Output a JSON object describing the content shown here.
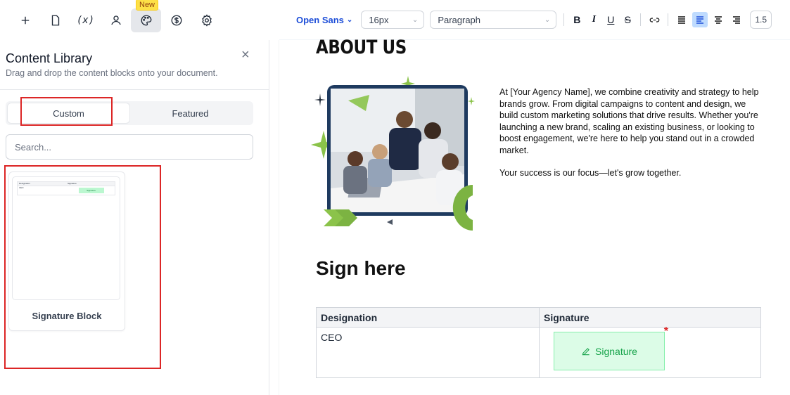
{
  "toolbar": {
    "new_badge": "New",
    "fx_label": "(x)"
  },
  "editor_toolbar": {
    "font": "Open Sans",
    "size": "16px",
    "block": "Paragraph",
    "bold": "B",
    "italic": "I",
    "underline": "U",
    "strike": "S",
    "line_height": "1.5"
  },
  "sidebar": {
    "title": "Content Library",
    "subtitle": "Drag and drop the content blocks onto your document.",
    "tabs": [
      {
        "label": "Custom"
      },
      {
        "label": "Featured"
      }
    ],
    "search_placeholder": "Search...",
    "card": {
      "label": "Signature Block",
      "thumb_col1": "Designation",
      "thumb_col2": "Signature",
      "thumb_row": "CEO",
      "thumb_sig": "Signature"
    }
  },
  "document": {
    "about_heading": "ABOUT US",
    "about_paragraphs": [
      "At [Your Agency Name], we combine creativity and strategy to help brands grow. From digital campaigns to content and design, we build custom marketing solutions that drive results.  Whether you're launching a new brand, scaling an existing business, or looking to boost engagement, we're here to help you stand out in a crowded market.",
      "Your success is our focus—let's grow together."
    ],
    "sign_heading": "Sign here",
    "table": {
      "headers": [
        "Designation",
        "Signature"
      ],
      "row": {
        "designation": "CEO",
        "signature": "Signature"
      }
    }
  },
  "colors": {
    "accent": "#1d4ed8",
    "highlight": "#dc2626",
    "signature_bg": "#dcfce7",
    "signature_text": "#16a34a"
  }
}
